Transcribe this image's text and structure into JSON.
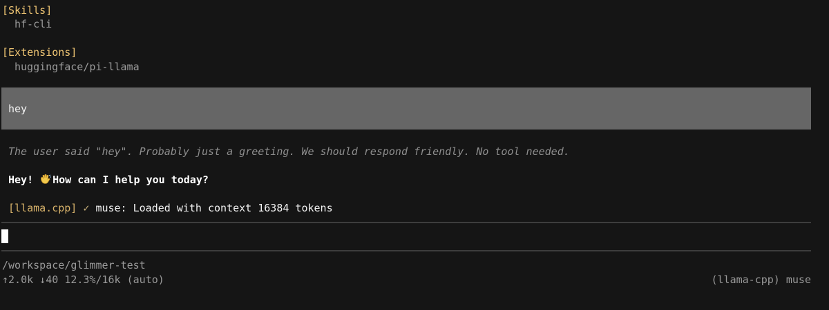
{
  "sections": {
    "skills": {
      "title": "[Skills]",
      "items": [
        "hf-cli"
      ]
    },
    "extensions": {
      "title": "[Extensions]",
      "items": [
        "huggingface/pi-llama"
      ]
    }
  },
  "conversation": {
    "user_message": "hey",
    "thinking": "The user said \"hey\". Probably just a greeting. We should respond friendly. No tool needed.",
    "assistant_before": "Hey!",
    "assistant_icon": "waving-hand-icon",
    "assistant_after": "How can I help you today?",
    "status_tag": "[llama.cpp]",
    "status_check": "✓",
    "status_text": "muse: Loaded with context 16384 tokens"
  },
  "input": {
    "value": ""
  },
  "footer": {
    "cwd": "/workspace/glimmer-test",
    "stats": "↑2.0k ↓40 12.3%/16k (auto)",
    "model": "(llama-cpp) muse"
  },
  "colors": {
    "background": "#151515",
    "section_title": "#f0c674",
    "user_message_bg": "#666666",
    "divider": "#3d3d3d"
  }
}
